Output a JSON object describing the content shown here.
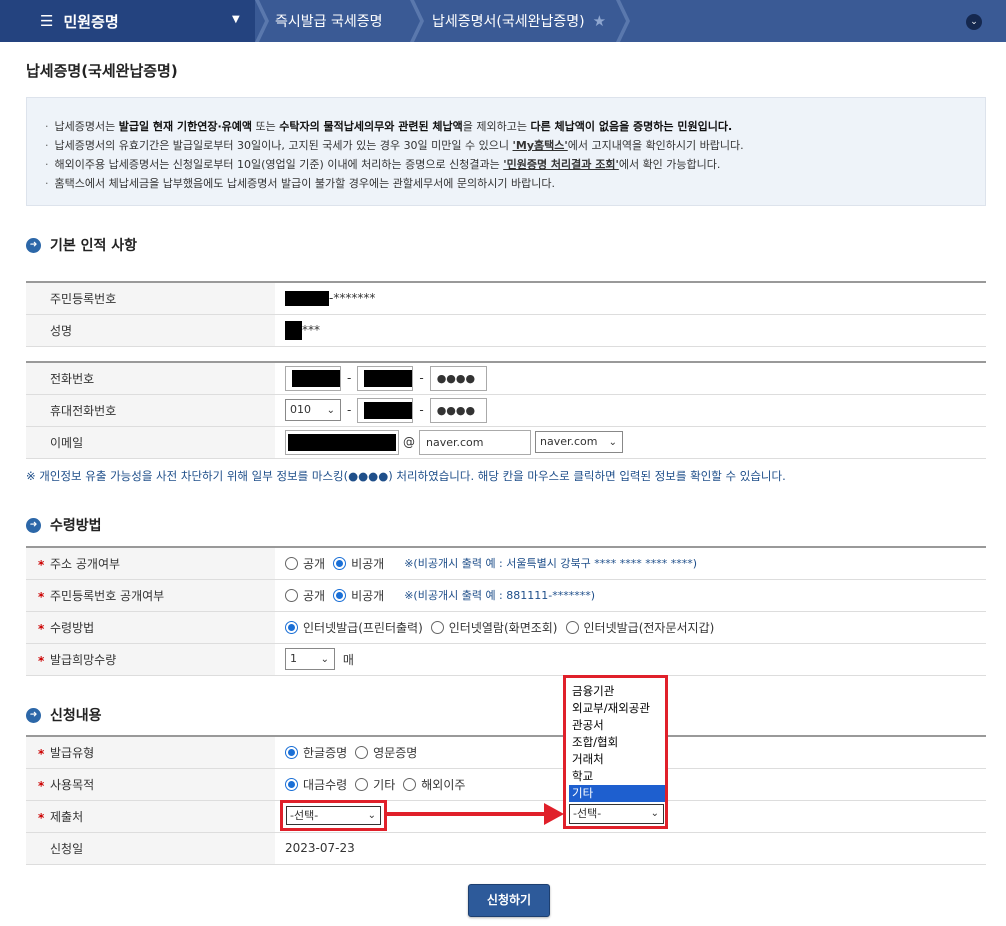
{
  "nav": {
    "menu_icon": "hamburger-icon",
    "menu_label": "민원증명",
    "crumb1": "즉시발급 국세증명",
    "crumb2": "납세증명서(국세완납증명)",
    "star_icon": "star-icon",
    "expand_icon": "chevron-down-icon"
  },
  "page": {
    "title": "납세증명(국세완납증명)"
  },
  "notice": {
    "line1_a": "납세증명서는 ",
    "line1_b": "발급일 현재 기한연장·유예액",
    "line1_c": " 또는 ",
    "line1_d": "수탁자의 물적납세의무와 관련된 체납액",
    "line1_e": "을 제외하고는 ",
    "line1_f": "다른 체납액이 없음을 증명하는 민원입니다.",
    "line2_a": "납세증명서의 유효기간은 발급일로부터 30일이나, 고지된 국세가 있는 경우 30일 미만일 수 있으니 ",
    "line2_link": "'My홈택스'",
    "line2_b": "에서 고지내역을 확인하시기 바랍니다.",
    "line3_a": "해외이주용 납세증명서는 신청일로부터 10일(영업일 기준) 이내에 처리하는 증명으로 신청결과는 ",
    "line3_link": "'민원증명 처리결과 조회'",
    "line3_b": "에서 확인 가능합니다.",
    "line4": "홈택스에서 체납세금을 납부했음에도 납세증명서 발급이 불가할 경우에는 관할세무서에 문의하시기 바랍니다."
  },
  "basic": {
    "section_title": "기본 인적 사항",
    "rrn_label": "주민등록번호",
    "rrn_suffix": "-*******",
    "name_label": "성명",
    "name_suffix": "***",
    "phone_label": "전화번호",
    "phone_dash": "-",
    "phone_last": "●●●●",
    "mobile_label": "휴대전화번호",
    "mobile_prefix": "010",
    "mobile_last": "●●●●",
    "email_label": "이메일",
    "email_at": "@",
    "email_domain": "naver.com",
    "email_domain_select": "naver.com"
  },
  "mask_note": "※ 개인정보 유출 가능성을 사전 차단하기 위해 일부 정보를 마스킹(●●●●) 처리하였습니다. 해당 칸을 마우스로 클릭하면 입력된 정보를 확인할 수 있습니다.",
  "receive": {
    "section_title": "수령방법",
    "required_mark": "*",
    "address_label": "주소 공개여부",
    "open": "공개",
    "closed": "비공개",
    "address_hint": "※(비공개시 출력 예 : 서울특별시 강북구 **** **** **** ****)",
    "rrn_open_label": "주민등록번호 공개여부",
    "rrn_hint": "※(비공개시 출력 예 : 881111-*******)",
    "method_label": "수령방법",
    "method_opt1": "인터넷발급(프린터출력)",
    "method_opt2": "인터넷열람(화면조회)",
    "method_opt3": "인터넷발급(전자문서지갑)",
    "qty_label": "발급희망수량",
    "qty_value": "1",
    "qty_unit": "매"
  },
  "apply": {
    "section_title": "신청내용",
    "type_label": "발급유형",
    "type_opt1": "한글증명",
    "type_opt2": "영문증명",
    "purpose_label": "사용목적",
    "purpose_opt1": "대금수령",
    "purpose_opt2": "기타",
    "purpose_opt3": "해외이주",
    "submit_to_label": "제출처",
    "submit_to_value": "-선택-",
    "date_label": "신청일",
    "date_value": "2023-07-23"
  },
  "dropdown": {
    "options": [
      "금융기관",
      "외교부/재외공관",
      "관공서",
      "조합/협회",
      "거래처",
      "학교",
      "기타"
    ],
    "selected_index": 6,
    "value": "-선택-"
  },
  "submit_label": "신청하기",
  "colors": {
    "nav_bg": "#3a5a95",
    "nav_menu_bg": "#24437f",
    "highlight_red": "#e0202a",
    "radio_blue": "#1a6fd6"
  }
}
